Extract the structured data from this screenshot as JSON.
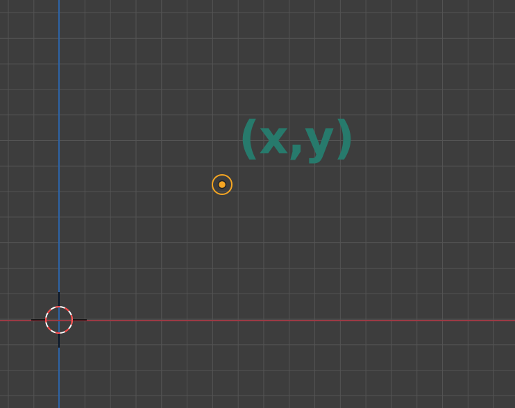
{
  "viewport": {
    "background_color": "#3d3d3d",
    "grid_color": "#545454",
    "y_axis_color": "#2d63a6",
    "x_axis_color": "#9b3a45"
  },
  "cursor_3d": {
    "icon": "3d-cursor-icon",
    "ring_colors": [
      "#ff4444",
      "#ffffff"
    ],
    "crosshair_color": "#000000"
  },
  "object_origin": {
    "icon": "origin-point-icon",
    "ring_color": "#f5a623",
    "dot_color": "#f5a623"
  },
  "annotation": {
    "text": "(x,y)",
    "color": "#277a6c"
  }
}
